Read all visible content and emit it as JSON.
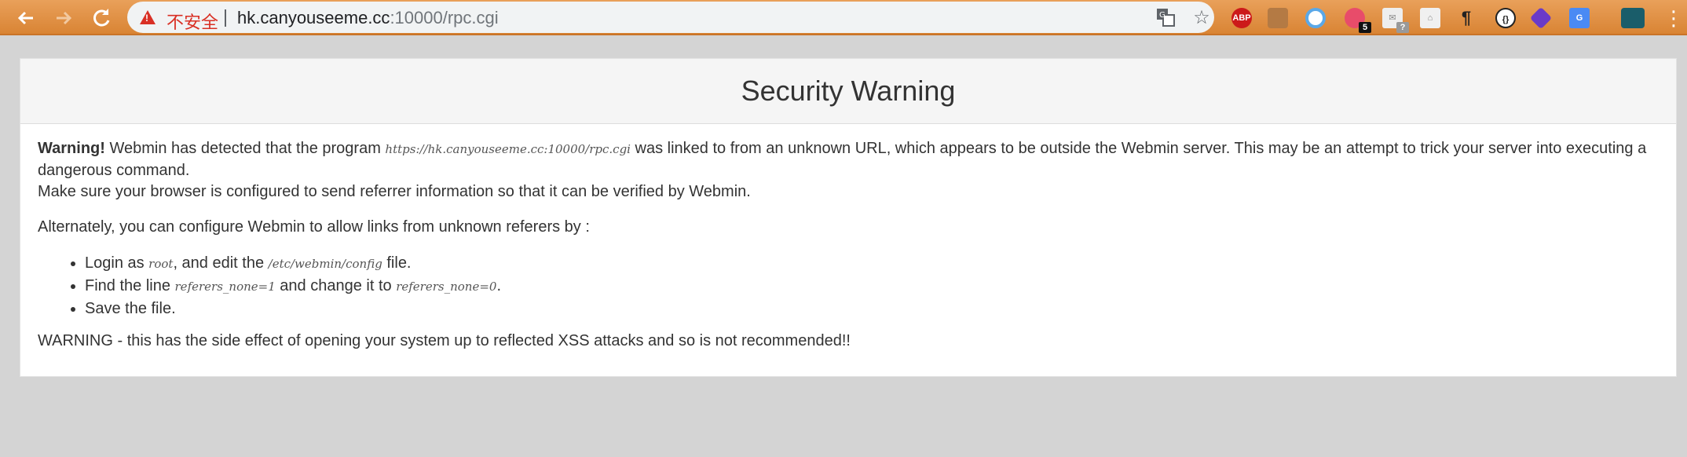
{
  "browser": {
    "back_icon": "arrow-left-icon",
    "forward_icon": "arrow-right-icon",
    "reload_icon": "reload-icon",
    "security_label": "不安全",
    "url_host": "hk.canyouseeme.cc",
    "url_rest": ":10000/rpc.cgi",
    "extensions": {
      "abp_label": "ABP",
      "badge_five": "5",
      "badge_q": "?",
      "para_glyph": "¶"
    }
  },
  "page": {
    "title": "Security Warning",
    "warning_label": "Warning!",
    "intro_1": " Webmin has detected that the program ",
    "program_url": "https://hk.canyouseeme.cc:10000/rpc.cgi",
    "intro_2": " was linked to from an unknown URL, which appears to be outside the Webmin server. This may be an attempt to trick your server into executing a dangerous command.",
    "referrer_note": "Make sure your browser is configured to send referrer information so that it can be verified by Webmin.",
    "alternate": "Alternately, you can configure Webmin to allow links from unknown referers by :",
    "steps": {
      "s1_a": "Login as ",
      "s1_user": "root",
      "s1_b": ", and edit the ",
      "s1_file": "/etc/webmin/config",
      "s1_c": " file.",
      "s2_a": "Find the line ",
      "s2_old": "referers_none=1",
      "s2_b": " and change it to ",
      "s2_new": "referers_none=0",
      "s2_c": ".",
      "s3": "Save the file."
    },
    "final_warning": "WARNING - this has the side effect of opening your system up to reflected XSS attacks and so is not recommended!!"
  }
}
